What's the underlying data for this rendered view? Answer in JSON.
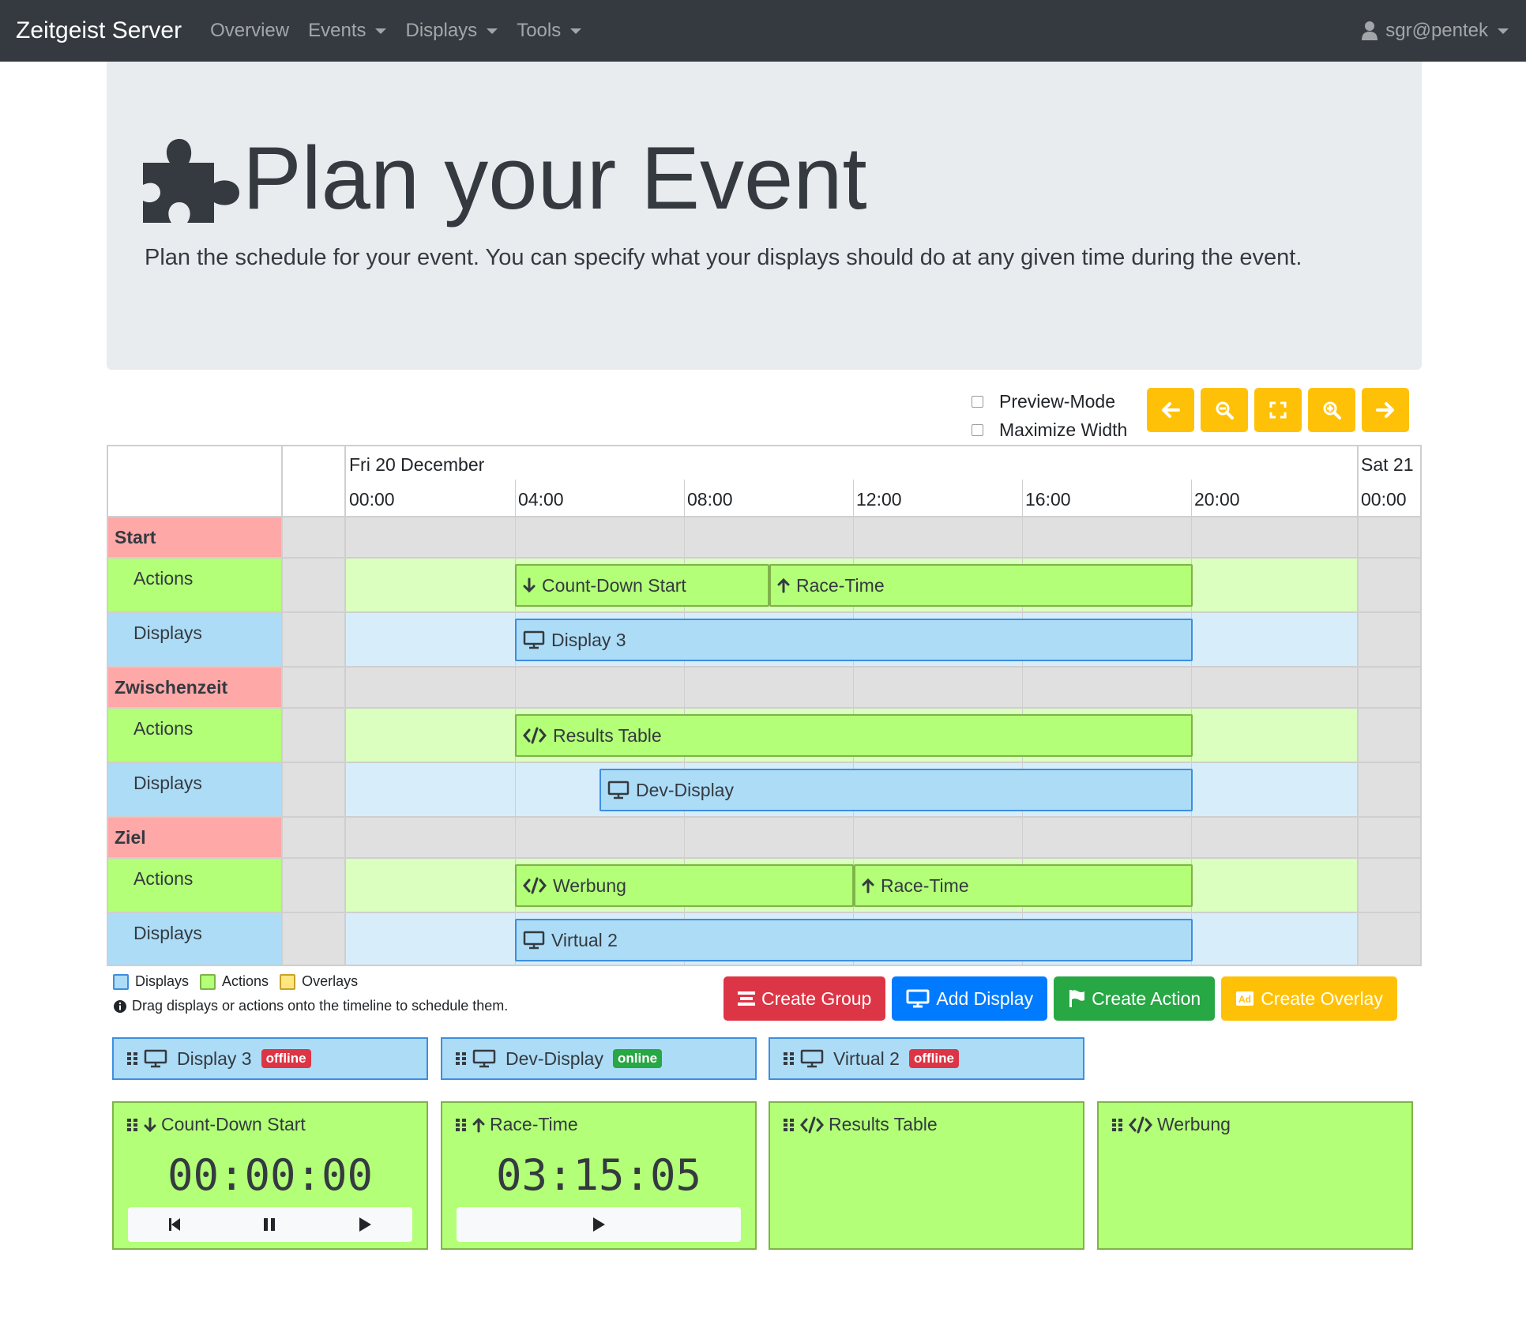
{
  "navbar": {
    "brand": "Zeitgeist Server",
    "items": [
      {
        "label": "Overview",
        "dropdown": false
      },
      {
        "label": "Events",
        "dropdown": true
      },
      {
        "label": "Displays",
        "dropdown": true
      },
      {
        "label": "Tools",
        "dropdown": true
      }
    ],
    "user": "sgr@pentek"
  },
  "jumbotron": {
    "title": "Plan your Event",
    "lead": "Plan the schedule for your event. You can specify what your displays should do at any given time during the event.",
    "icon": "puzzle-piece-icon"
  },
  "controls": {
    "preview_mode": "Preview-Mode",
    "maximize_width": "Maximize Width",
    "buttons": [
      "arrow-left-icon",
      "zoom-out-icon",
      "expand-icon",
      "zoom-in-icon",
      "arrow-right-icon"
    ]
  },
  "timeline": {
    "date_left": "Fri 20 December",
    "date_right": "Sat 21",
    "hours": [
      "00:00",
      "04:00",
      "08:00",
      "12:00",
      "16:00",
      "20:00"
    ],
    "hour_right": "00:00",
    "groups": [
      {
        "name": "Start",
        "actions_label": "Actions",
        "displays_label": "Displays",
        "actions": [
          {
            "label": "Count-Down Start",
            "icon": "arrow-down-icon"
          },
          {
            "label": "Race-Time",
            "icon": "arrow-up-icon"
          }
        ],
        "displays": [
          {
            "label": "Display 3",
            "icon": "desktop-icon"
          }
        ]
      },
      {
        "name": "Zwischenzeit",
        "actions_label": "Actions",
        "displays_label": "Displays",
        "actions": [
          {
            "label": "Results Table",
            "icon": "code-icon"
          }
        ],
        "displays": [
          {
            "label": "Dev-Display",
            "icon": "desktop-icon"
          }
        ]
      },
      {
        "name": "Ziel",
        "actions_label": "Actions",
        "displays_label": "Displays",
        "actions": [
          {
            "label": "Werbung",
            "icon": "code-icon"
          },
          {
            "label": "Race-Time",
            "icon": "arrow-up-icon"
          }
        ],
        "displays": [
          {
            "label": "Virtual 2",
            "icon": "desktop-icon"
          }
        ]
      }
    ]
  },
  "legend": {
    "displays": "Displays",
    "actions": "Actions",
    "overlays": "Overlays",
    "hint": "Drag displays or actions onto the timeline to schedule them."
  },
  "create_buttons": {
    "group": "Create Group",
    "display": "Add Display",
    "action": "Create Action",
    "overlay": "Create Overlay"
  },
  "display_cards": [
    {
      "name": "Display 3",
      "status": "offline"
    },
    {
      "name": "Dev-Display",
      "status": "online"
    },
    {
      "name": "Virtual 2",
      "status": "offline"
    }
  ],
  "action_cards": [
    {
      "name": "Count-Down Start",
      "icon": "arrow-down-icon",
      "timer": "00:00:00",
      "controls": [
        "skip-back-icon",
        "pause-icon",
        "play-icon"
      ]
    },
    {
      "name": "Race-Time",
      "icon": "arrow-up-icon",
      "timer": "03:15:05",
      "controls": [
        "play-icon"
      ]
    },
    {
      "name": "Results Table",
      "icon": "code-icon"
    },
    {
      "name": "Werbung",
      "icon": "code-icon"
    }
  ],
  "colors": {
    "navbar": "#343a40",
    "group": "#ffa8a8",
    "action": "#b3ff77",
    "display": "#addcf7",
    "warning": "#ffc107",
    "danger": "#dc3545",
    "primary": "#007bff",
    "success": "#28a745"
  }
}
